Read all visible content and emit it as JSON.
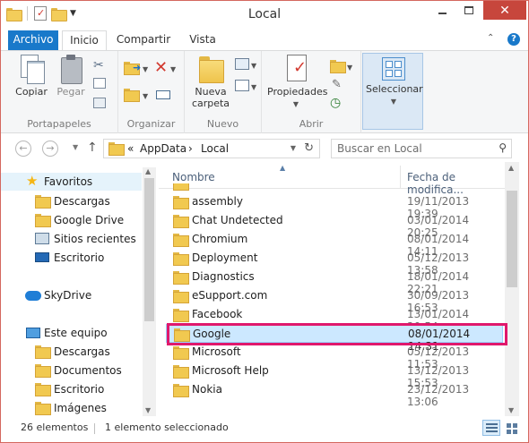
{
  "window": {
    "title": "Local"
  },
  "ribbon_tabs": {
    "file": "Archivo",
    "home": "Inicio",
    "share": "Compartir",
    "view": "Vista"
  },
  "ribbon": {
    "clipboard": {
      "copy": "Copiar",
      "paste": "Pegar",
      "label": "Portapapeles"
    },
    "organize": {
      "label": "Organizar"
    },
    "new": {
      "new_folder_line1": "Nueva",
      "new_folder_line2": "carpeta",
      "label": "Nuevo"
    },
    "open": {
      "properties": "Propiedades",
      "label": "Abrir"
    },
    "select": {
      "select": "Seleccionar"
    }
  },
  "address": {
    "prefix": "«",
    "crumbs": [
      "AppData",
      "Local"
    ],
    "sep": "›"
  },
  "search": {
    "placeholder": "Buscar en Local"
  },
  "navpane": {
    "favorites": "Favoritos",
    "favorite_items": [
      "Descargas",
      "Google Drive",
      "Sitios recientes",
      "Escritorio"
    ],
    "skydrive": "SkyDrive",
    "this_pc": "Este equipo",
    "pc_items": [
      "Descargas",
      "Documentos",
      "Escritorio",
      "Imágenes"
    ]
  },
  "columns": {
    "name": "Nombre",
    "date": "Fecha de modifica..."
  },
  "files": [
    {
      "name": "assembly",
      "date": "19/11/2013 19:39",
      "selected": false
    },
    {
      "name": "Chat Undetected",
      "date": "03/01/2014 20:25",
      "selected": false
    },
    {
      "name": "Chromium",
      "date": "08/01/2014 14:11",
      "selected": false
    },
    {
      "name": "Deployment",
      "date": "05/12/2013 13:58",
      "selected": false
    },
    {
      "name": "Diagnostics",
      "date": "18/01/2014 22:21",
      "selected": false
    },
    {
      "name": "eSupport.com",
      "date": "30/09/2013 16:53",
      "selected": false
    },
    {
      "name": "Facebook",
      "date": "13/01/2014 20:54",
      "selected": false
    },
    {
      "name": "Google",
      "date": "08/01/2014 14:31",
      "selected": true
    },
    {
      "name": "Microsoft",
      "date": "05/12/2013 11:53",
      "selected": false
    },
    {
      "name": "Microsoft Help",
      "date": "13/12/2013 15:53",
      "selected": false
    },
    {
      "name": "Nokia",
      "date": "23/12/2013 13:06",
      "selected": false
    }
  ],
  "status": {
    "count": "26 elementos",
    "selection": "1 elemento seleccionado"
  },
  "colors": {
    "accent": "#1979ca",
    "selection": "#cce8ff",
    "highlight": "#e0186c"
  }
}
